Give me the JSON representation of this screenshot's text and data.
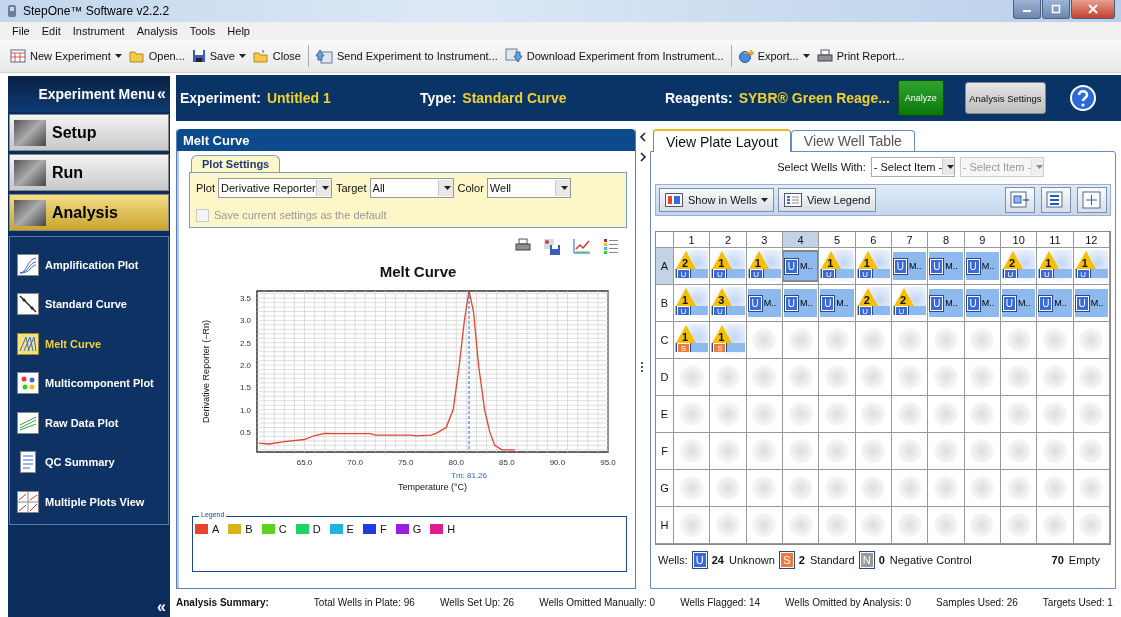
{
  "window": {
    "title": "StepOne™ Software v2.2.2"
  },
  "menu": [
    "File",
    "Edit",
    "Instrument",
    "Analysis",
    "Tools",
    "Help"
  ],
  "toolbar": [
    {
      "kind": "new",
      "label": "New Experiment",
      "dropdown": true,
      "separator_before": false
    },
    {
      "kind": "open",
      "label": "Open...",
      "dropdown": false,
      "separator_before": false
    },
    {
      "kind": "save",
      "label": "Save",
      "dropdown": true,
      "separator_before": false
    },
    {
      "kind": "close",
      "label": "Close",
      "dropdown": false,
      "separator_before": false
    },
    {
      "kind": "send",
      "label": "Send Experiment to Instrument...",
      "dropdown": false,
      "separator_before": true
    },
    {
      "kind": "download",
      "label": "Download Experiment from Instrument...",
      "dropdown": false,
      "separator_before": false
    },
    {
      "kind": "export",
      "label": "Export...",
      "dropdown": true,
      "separator_before": true
    },
    {
      "kind": "print",
      "label": "Print Report...",
      "dropdown": false,
      "separator_before": false
    }
  ],
  "experiment_bar": {
    "experiment_label": "Experiment:",
    "experiment": "Untitled 1",
    "type_label": "Type:",
    "type": "Standard Curve",
    "reagents_label": "Reagents:",
    "reagents": "SYBR® Green Reage...",
    "analyze": "Analyze",
    "settings": "Analysis Settings"
  },
  "sidebar": {
    "title": "Experiment Menu",
    "collapse": "«",
    "sections": [
      {
        "label": "Setup",
        "selected": false
      },
      {
        "label": "Run",
        "selected": false
      },
      {
        "label": "Analysis",
        "selected": true
      }
    ],
    "items": [
      {
        "kind": "amplification",
        "label": "Amplification Plot",
        "selected": false
      },
      {
        "kind": "standard",
        "label": "Standard Curve",
        "selected": false
      },
      {
        "kind": "melt",
        "label": "Melt Curve",
        "selected": true
      },
      {
        "kind": "multicomponent",
        "label": "Multicomponent Plot",
        "selected": false
      },
      {
        "kind": "raw",
        "label": "Raw Data Plot",
        "selected": false
      },
      {
        "kind": "qc",
        "label": "QC Summary",
        "selected": false
      },
      {
        "kind": "multiple",
        "label": "Multiple Plots View",
        "selected": false
      }
    ],
    "footer": "«"
  },
  "melt_panel": {
    "title": "Melt Curve",
    "plot_settings": {
      "tab": "Plot Settings",
      "fields": [
        {
          "label": "Plot",
          "value": "Derivative Reporter"
        },
        {
          "label": "Target",
          "value": "All"
        },
        {
          "label": "Color",
          "value": "Well"
        }
      ],
      "save_default": {
        "label": "Save current settings as the default",
        "checked": false,
        "disabled": true
      }
    },
    "chart_data": {
      "type": "line",
      "title": "Melt Curve",
      "xlabel": "Temperature (°C)",
      "ylabel": "Derivative Reporter (−Rn)",
      "x": [
        60.5,
        61.5,
        63,
        65,
        66,
        67,
        68,
        71.5,
        72,
        75.5,
        76,
        77.5,
        78,
        79,
        79.7,
        80.3,
        80.8,
        81.26,
        81.7,
        82.2,
        82.8,
        83.3,
        83.8,
        84.5,
        85.8
      ],
      "series": [
        {
          "name": "A",
          "color": "#e8432e",
          "values": [
            0.25,
            0.23,
            0.28,
            0.33,
            0.42,
            0.47,
            0.46,
            0.46,
            0.43,
            0.43,
            0.41,
            0.43,
            0.47,
            0.6,
            1.0,
            2.0,
            3.0,
            3.66,
            3.2,
            2.0,
            1.0,
            0.5,
            0.2,
            0.1,
            0.1
          ]
        }
      ],
      "xlim": [
        60.3,
        95
      ],
      "ylim": [
        0.05,
        3.66
      ],
      "xticks": [
        {
          "value": 65,
          "label": "65.0"
        },
        {
          "value": 70,
          "label": "70.0"
        },
        {
          "value": 75,
          "label": "75.0"
        },
        {
          "value": 80,
          "label": "80.0"
        },
        {
          "value": 85,
          "label": "85.0"
        },
        {
          "value": 90,
          "label": "90.0"
        },
        {
          "value": 95,
          "label": "95.0"
        }
      ],
      "yticks": [
        {
          "value": 0.5,
          "label": "0.5"
        },
        {
          "value": 1,
          "label": "1.0"
        },
        {
          "value": 1.5,
          "label": "1.5"
        },
        {
          "value": 2,
          "label": "2.0"
        },
        {
          "value": 2.5,
          "label": "2.5"
        },
        {
          "value": 3,
          "label": "3.0"
        },
        {
          "value": 3.5,
          "label": "3.5"
        }
      ],
      "grid": true,
      "ref_lines": [
        {
          "axis": "x",
          "value": 81.26,
          "label": "Tm: 81.26",
          "color": "#2a6ad8"
        }
      ]
    },
    "legend": {
      "title": "Legend",
      "items": [
        {
          "label": "B",
          "color": "#d4b514"
        },
        {
          "label": "C",
          "color": "#5fd21e"
        },
        {
          "label": "D",
          "color": "#1ed264"
        },
        {
          "label": "E",
          "color": "#1eb4e0"
        },
        {
          "label": "F",
          "color": "#1e3ce0"
        },
        {
          "label": "G",
          "color": "#9a1ee0"
        },
        {
          "label": "H",
          "color": "#e01e8c"
        }
      ]
    }
  },
  "plate_panel": {
    "tabs": [
      {
        "label": "View Plate Layout",
        "selected": true
      },
      {
        "label": "View Well Table",
        "selected": false
      }
    ],
    "select_label": "Select Wells With:",
    "selects": [
      {
        "value": "- Select Item -",
        "disabled": false
      },
      {
        "value": "- Select Item -",
        "disabled": true
      }
    ],
    "show_in_wells": "Show in Wells",
    "view_legend": "View Legend",
    "columns": [
      {
        "label": "1",
        "selected": false
      },
      {
        "label": "2",
        "selected": false
      },
      {
        "label": "3",
        "selected": false
      },
      {
        "label": "4",
        "selected": true
      },
      {
        "label": "5",
        "selected": false
      },
      {
        "label": "6",
        "selected": false
      },
      {
        "label": "7",
        "selected": false
      },
      {
        "label": "8",
        "selected": false
      },
      {
        "label": "9",
        "selected": false
      },
      {
        "label": "10",
        "selected": false
      },
      {
        "label": "11",
        "selected": false
      },
      {
        "label": "12",
        "selected": false
      }
    ],
    "rows": [
      {
        "label": "A",
        "selected": true,
        "wells": [
          {
            "kind": "flagged",
            "flag": "2",
            "task": {
              "letter": "U",
              "color": "#3a6ad8"
            },
            "selected": false
          },
          {
            "kind": "flagged",
            "flag": "1",
            "task": {
              "letter": "U",
              "color": "#3a6ad8"
            },
            "selected": false
          },
          {
            "kind": "flagged",
            "flag": "1",
            "task": {
              "letter": "U",
              "color": "#3a6ad8"
            },
            "selected": false
          },
          {
            "kind": "task",
            "task": {
              "letter": "U",
              "color": "#3a6ad8"
            },
            "label": "M..",
            "selected": true
          },
          {
            "kind": "flagged",
            "flag": "1",
            "task": {
              "letter": "U",
              "color": "#3a6ad8"
            },
            "selected": false
          },
          {
            "kind": "flagged",
            "flag": "1",
            "task": {
              "letter": "U",
              "color": "#3a6ad8"
            },
            "selected": false
          },
          {
            "kind": "task",
            "task": {
              "letter": "U",
              "color": "#3a6ad8"
            },
            "label": "M..",
            "selected": false
          },
          {
            "kind": "task",
            "task": {
              "letter": "U",
              "color": "#3a6ad8"
            },
            "label": "M..",
            "selected": false
          },
          {
            "kind": "task",
            "task": {
              "letter": "U",
              "color": "#3a6ad8"
            },
            "label": "M..",
            "selected": false
          },
          {
            "kind": "flagged",
            "flag": "2",
            "task": {
              "letter": "U",
              "color": "#3a6ad8"
            },
            "selected": false
          },
          {
            "kind": "flagged",
            "flag": "1",
            "task": {
              "letter": "U",
              "color": "#3a6ad8"
            },
            "selected": false
          },
          {
            "kind": "flagged",
            "flag": "1",
            "task": {
              "letter": "U",
              "color": "#3a6ad8"
            },
            "selected": false
          }
        ]
      },
      {
        "label": "B",
        "selected": false,
        "wells": [
          {
            "kind": "flagged",
            "flag": "1",
            "task": {
              "letter": "U",
              "color": "#3a6ad8"
            },
            "selected": false
          },
          {
            "kind": "flagged",
            "flag": "3",
            "task": {
              "letter": "U",
              "color": "#3a6ad8"
            },
            "selected": false
          },
          {
            "kind": "task",
            "task": {
              "letter": "U",
              "color": "#3a6ad8"
            },
            "label": "M..",
            "selected": false
          },
          {
            "kind": "task",
            "task": {
              "letter": "U",
              "color": "#3a6ad8"
            },
            "label": "M..",
            "selected": false
          },
          {
            "kind": "task",
            "task": {
              "letter": "U",
              "color": "#3a6ad8"
            },
            "label": "M..",
            "selected": false
          },
          {
            "kind": "flagged",
            "flag": "2",
            "task": {
              "letter": "U",
              "color": "#3a6ad8"
            },
            "selected": false
          },
          {
            "kind": "flagged",
            "flag": "2",
            "task": {
              "letter": "U",
              "color": "#3a6ad8"
            },
            "selected": false
          },
          {
            "kind": "task",
            "task": {
              "letter": "U",
              "color": "#3a6ad8"
            },
            "label": "M..",
            "selected": false
          },
          {
            "kind": "task",
            "task": {
              "letter": "U",
              "color": "#3a6ad8"
            },
            "label": "M..",
            "selected": false
          },
          {
            "kind": "task",
            "task": {
              "letter": "U",
              "color": "#3a6ad8"
            },
            "label": "M..",
            "selected": false
          },
          {
            "kind": "task",
            "task": {
              "letter": "U",
              "color": "#3a6ad8"
            },
            "label": "M..",
            "selected": false
          },
          {
            "kind": "task",
            "task": {
              "letter": "U",
              "color": "#3a6ad8"
            },
            "label": "M..",
            "selected": false
          }
        ]
      },
      {
        "label": "C",
        "selected": false,
        "wells": [
          {
            "kind": "flagged",
            "flag": "1",
            "task": {
              "letter": "S",
              "color": "#ee7a3a"
            },
            "selected": false
          },
          {
            "kind": "flagged",
            "flag": "1",
            "task": {
              "letter": "S",
              "color": "#ee7a3a"
            },
            "selected": false
          },
          {
            "kind": "empty",
            "selected": false
          },
          {
            "kind": "empty",
            "selected": false
          },
          {
            "kind": "empty",
            "selected": false
          },
          {
            "kind": "empty",
            "selected": false
          },
          {
            "kind": "empty",
            "selected": false
          },
          {
            "kind": "empty",
            "selected": false
          },
          {
            "kind": "empty",
            "selected": false
          },
          {
            "kind": "empty",
            "selected": false
          },
          {
            "kind": "empty",
            "selected": false
          },
          {
            "kind": "empty",
            "selected": false
          }
        ]
      },
      {
        "label": "D",
        "selected": false,
        "wells": [
          {
            "kind": "empty",
            "selected": false
          },
          {
            "kind": "empty",
            "selected": false
          },
          {
            "kind": "empty",
            "selected": false
          },
          {
            "kind": "empty",
            "selected": false
          },
          {
            "kind": "empty",
            "selected": false
          },
          {
            "kind": "empty",
            "selected": false
          },
          {
            "kind": "empty",
            "selected": false
          },
          {
            "kind": "empty",
            "selected": false
          },
          {
            "kind": "empty",
            "selected": false
          },
          {
            "kind": "empty",
            "selected": false
          },
          {
            "kind": "empty",
            "selected": false
          },
          {
            "kind": "empty",
            "selected": false
          }
        ]
      },
      {
        "label": "E",
        "selected": false,
        "wells": [
          {
            "kind": "empty",
            "selected": false
          },
          {
            "kind": "empty",
            "selected": false
          },
          {
            "kind": "empty",
            "selected": false
          },
          {
            "kind": "empty",
            "selected": false
          },
          {
            "kind": "empty",
            "selected": false
          },
          {
            "kind": "empty",
            "selected": false
          },
          {
            "kind": "empty",
            "selected": false
          },
          {
            "kind": "empty",
            "selected": false
          },
          {
            "kind": "empty",
            "selected": false
          },
          {
            "kind": "empty",
            "selected": false
          },
          {
            "kind": "empty",
            "selected": false
          },
          {
            "kind": "empty",
            "selected": false
          }
        ]
      },
      {
        "label": "F",
        "selected": false,
        "wells": [
          {
            "kind": "empty",
            "selected": false
          },
          {
            "kind": "empty",
            "selected": false
          },
          {
            "kind": "empty",
            "selected": false
          },
          {
            "kind": "empty",
            "selected": false
          },
          {
            "kind": "empty",
            "selected": false
          },
          {
            "kind": "empty",
            "selected": false
          },
          {
            "kind": "empty",
            "selected": false
          },
          {
            "kind": "empty",
            "selected": false
          },
          {
            "kind": "empty",
            "selected": false
          },
          {
            "kind": "empty",
            "selected": false
          },
          {
            "kind": "empty",
            "selected": false
          },
          {
            "kind": "empty",
            "selected": false
          }
        ]
      },
      {
        "label": "G",
        "selected": false,
        "wells": [
          {
            "kind": "empty",
            "selected": false
          },
          {
            "kind": "empty",
            "selected": false
          },
          {
            "kind": "empty",
            "selected": false
          },
          {
            "kind": "empty",
            "selected": false
          },
          {
            "kind": "empty",
            "selected": false
          },
          {
            "kind": "empty",
            "selected": false
          },
          {
            "kind": "empty",
            "selected": false
          },
          {
            "kind": "empty",
            "selected": false
          },
          {
            "kind": "empty",
            "selected": false
          },
          {
            "kind": "empty",
            "selected": false
          },
          {
            "kind": "empty",
            "selected": false
          },
          {
            "kind": "empty",
            "selected": false
          }
        ]
      },
      {
        "label": "H",
        "selected": false,
        "wells": [
          {
            "kind": "empty",
            "selected": false
          },
          {
            "kind": "empty",
            "selected": false
          },
          {
            "kind": "empty",
            "selected": false
          },
          {
            "kind": "empty",
            "selected": false
          },
          {
            "kind": "empty",
            "selected": false
          },
          {
            "kind": "empty",
            "selected": false
          },
          {
            "kind": "empty",
            "selected": false
          },
          {
            "kind": "empty",
            "selected": false
          },
          {
            "kind": "empty",
            "selected": false
          },
          {
            "kind": "empty",
            "selected": false
          },
          {
            "kind": "empty",
            "selected": false
          },
          {
            "kind": "empty",
            "selected": false
          }
        ]
      }
    ],
    "footer": {
      "label": "Wells:",
      "counts": [
        {
          "task": {
            "letter": "U",
            "color": "#3a6ad8"
          },
          "count": "24",
          "label": "Unknown"
        },
        {
          "task": {
            "letter": "S",
            "color": "#ee7a3a"
          },
          "count": "2",
          "label": "Standard"
        },
        {
          "task": {
            "letter": "N",
            "color": "#999999"
          },
          "count": "0",
          "label": "Negative Control"
        }
      ],
      "empty_count": "70",
      "empty_label": "Empty"
    }
  },
  "summary": {
    "title": "Analysis Summary:",
    "items": [
      "Total Wells in Plate: 96",
      "Wells Set Up: 26",
      "Wells Omitted Manually: 0",
      "Wells Flagged: 14",
      "Wells Omitted by Analysis: 0",
      "Samples Used: 26",
      "Targets Used: 1"
    ]
  }
}
